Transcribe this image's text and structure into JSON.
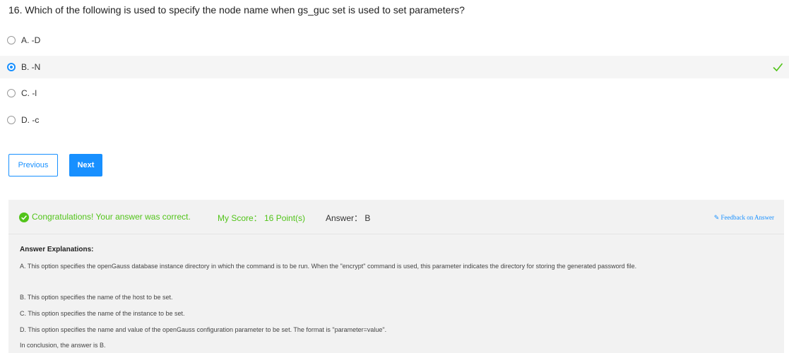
{
  "question": {
    "text": "16. Which of the following is used to specify the node name when gs_guc set is used to set parameters?"
  },
  "options": [
    {
      "label": "A. -D",
      "selected": false
    },
    {
      "label": "B. -N",
      "selected": true,
      "correct": true
    },
    {
      "label": "C. -l",
      "selected": false
    },
    {
      "label": "D. -c",
      "selected": false
    }
  ],
  "buttons": {
    "previous": "Previous",
    "next": "Next"
  },
  "result": {
    "message": "Congratulations! Your answer was correct.",
    "score": "My Score： 16 Point(s)",
    "answer": "Answer： B",
    "feedback": "Feedback on Answer"
  },
  "explanation": {
    "title": "Answer Explanations:",
    "lines": [
      "A. This option specifies the openGauss database instance directory in which the command is to be run. When the \"encrypt\" command is used, this parameter indicates the directory for storing the generated password file.",
      "B. This option specifies the name of the host to be set.",
      "C. This option specifies the name of the instance to be set.",
      "D. This option specifies the name and value of the openGauss configuration parameter to be set. The format is \"parameter=value\".",
      "In conclusion, the answer is B."
    ]
  },
  "colors": {
    "accent": "#1890ff",
    "success": "#52c41a",
    "panel": "#f2f2f2"
  },
  "icons": {
    "correct_mark": "check-icon",
    "result_ok": "check-circle-icon",
    "feedback": "pencil-icon"
  }
}
